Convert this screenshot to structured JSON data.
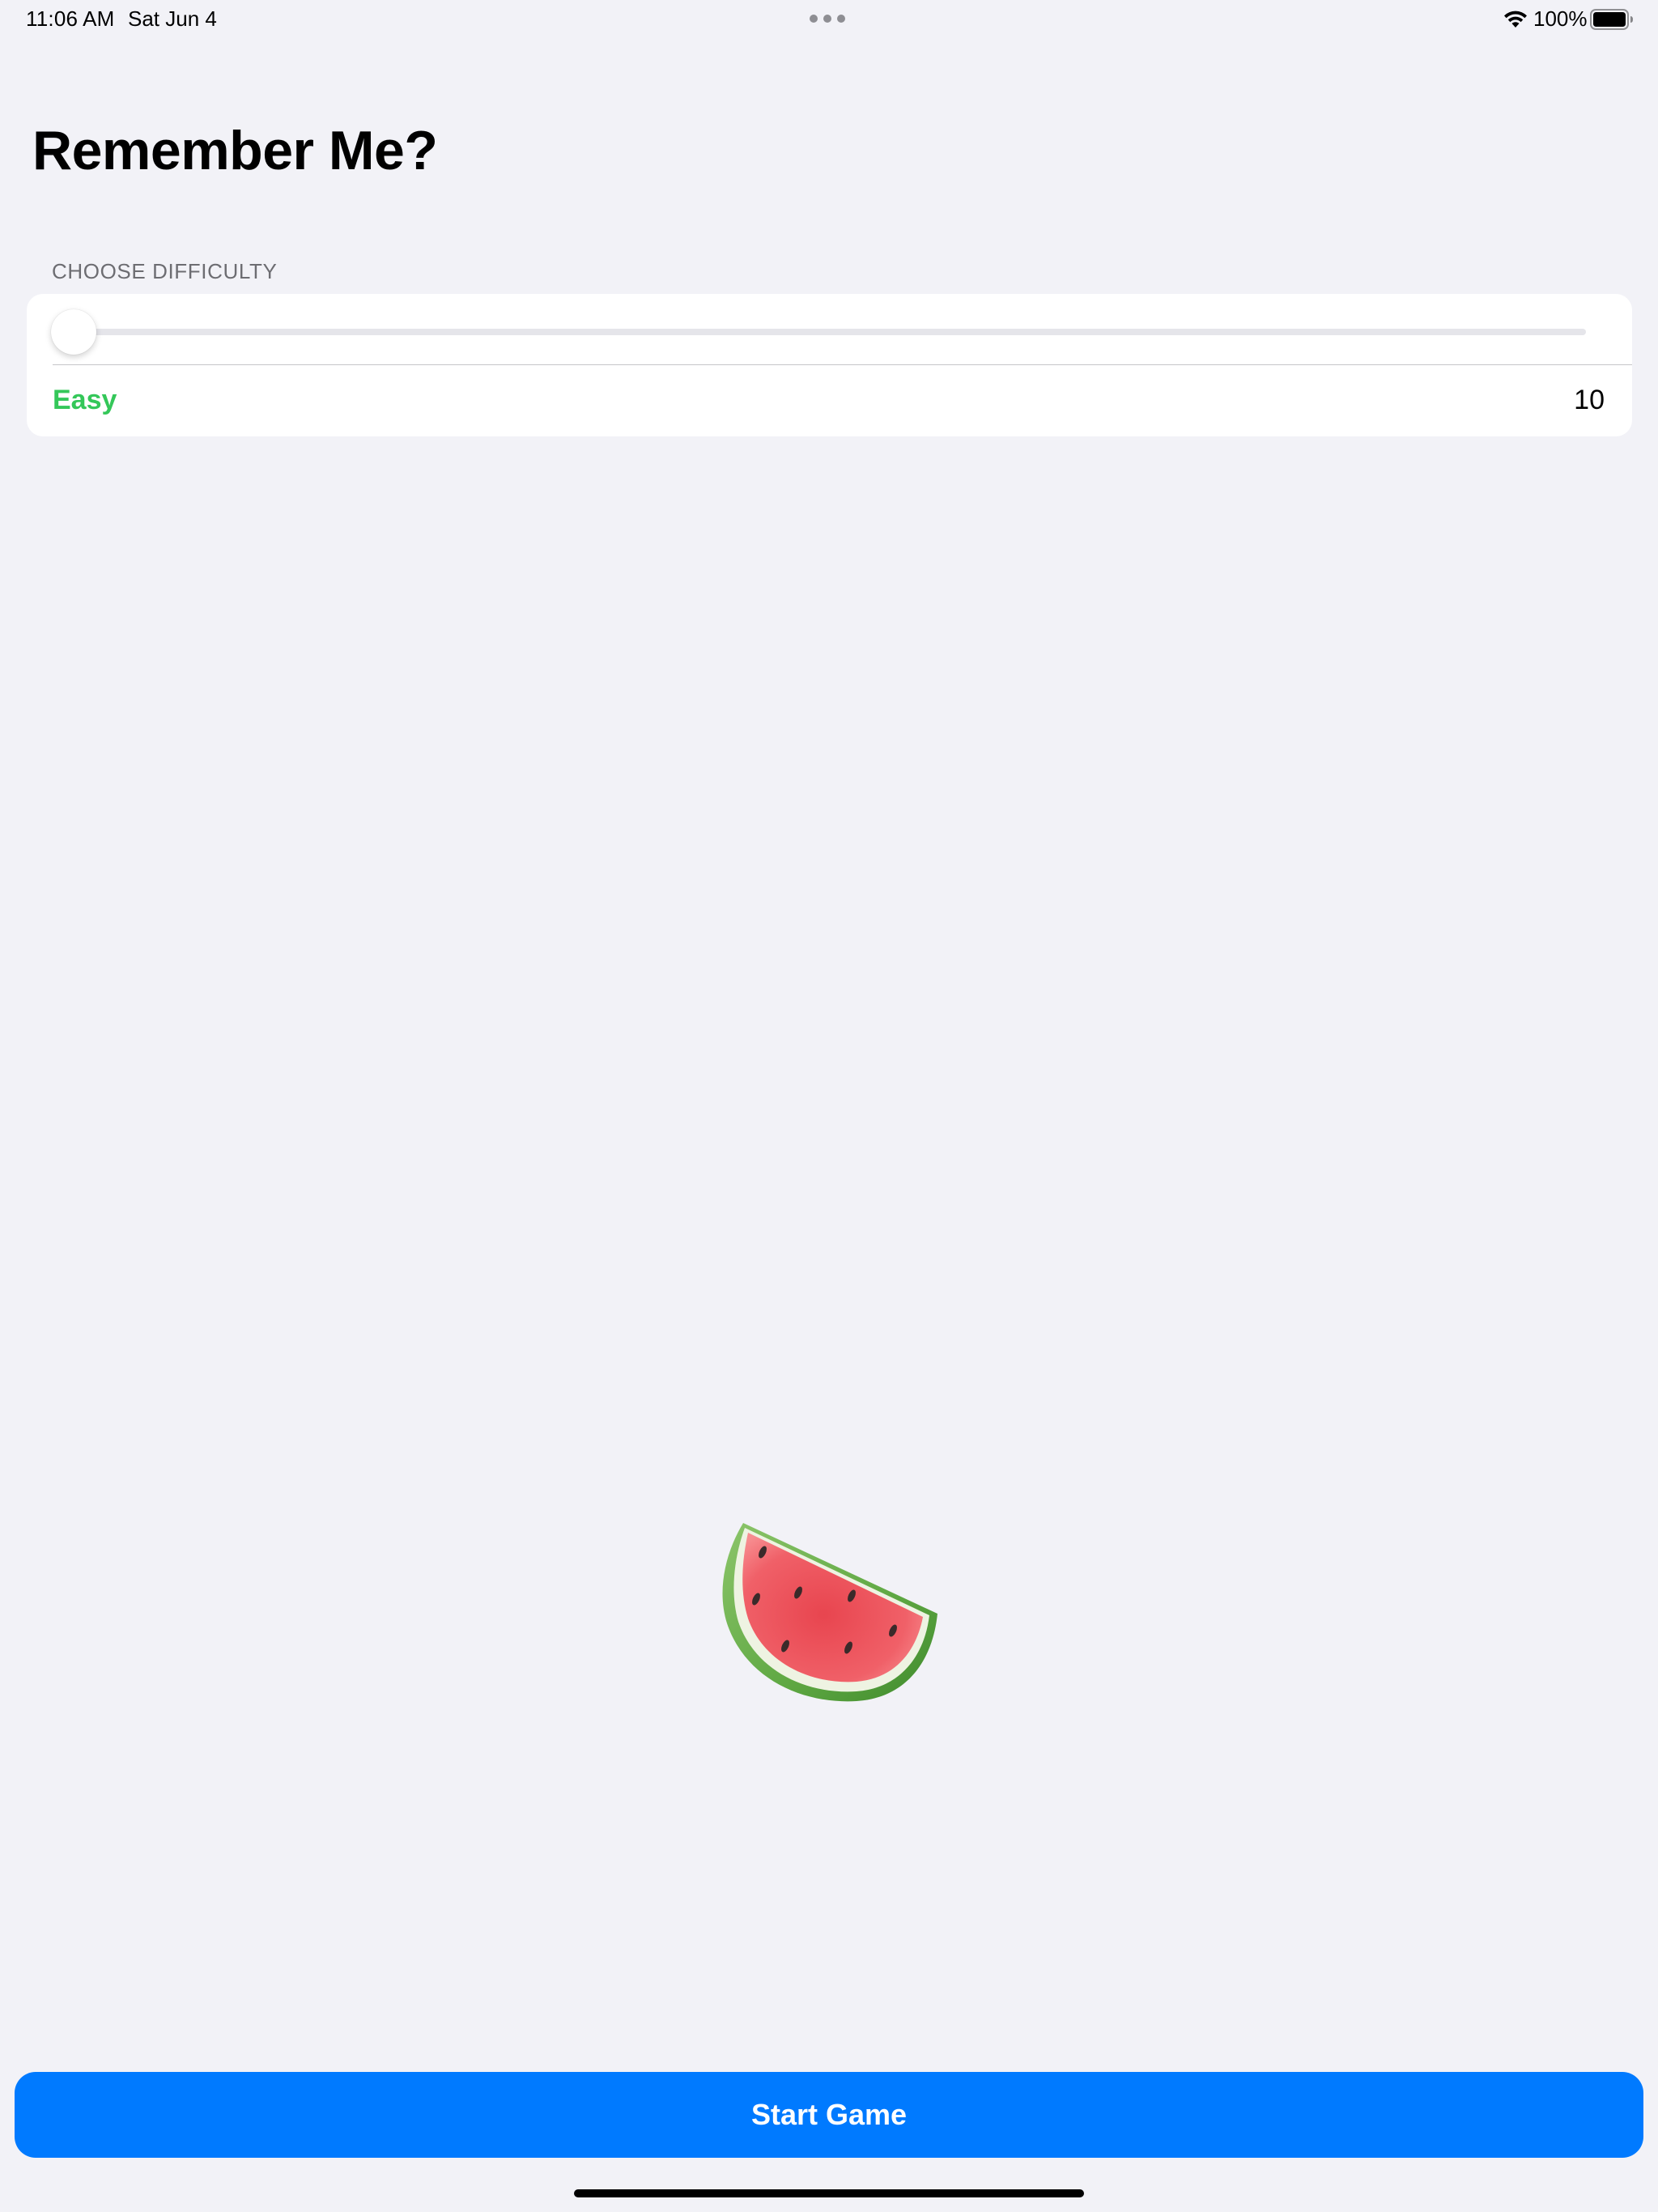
{
  "status_bar": {
    "time": "11:06 AM",
    "date": "Sat Jun 4",
    "battery_percent": "100%",
    "icons": [
      "multitasking-dots-icon",
      "wifi-icon",
      "battery-icon"
    ]
  },
  "page": {
    "title": "Remember Me?"
  },
  "difficulty": {
    "section_header": "CHOOSE DIFFICULTY",
    "level_label": "Easy",
    "value": "10",
    "slider_fraction": 0,
    "label_color": "#34c759"
  },
  "illustration": {
    "icon": "watermelon-icon"
  },
  "actions": {
    "start_label": "Start Game"
  },
  "colors": {
    "accent": "#007aff",
    "background": "#f2f2f7",
    "card": "#ffffff"
  }
}
